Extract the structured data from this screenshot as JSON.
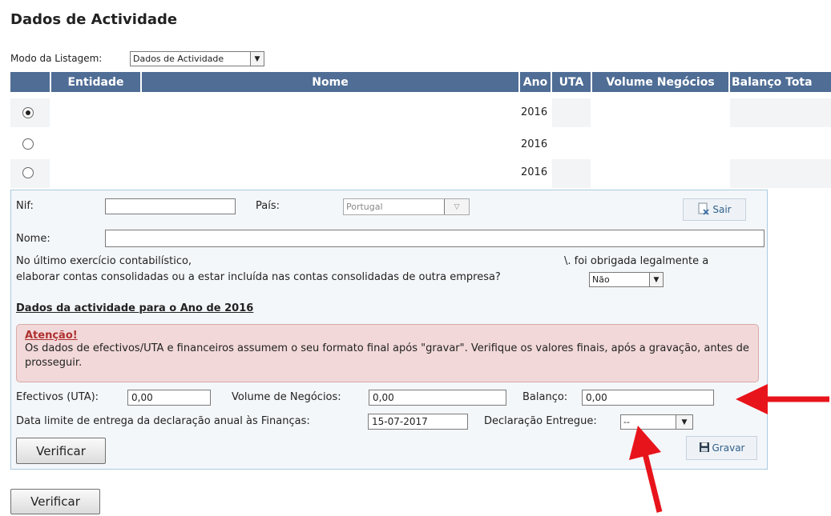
{
  "page": {
    "title": "Dados de Actividade"
  },
  "listing": {
    "mode_label": "Modo da Listagem:",
    "mode_value": "Dados de Actividade"
  },
  "table": {
    "headers": [
      "Entidade",
      "Nome",
      "Ano",
      "UTA",
      "Volume Negócios",
      "Balanço Tota"
    ],
    "rows": [
      {
        "selected": true,
        "year": "2016"
      },
      {
        "selected": false,
        "year": "2016"
      },
      {
        "selected": false,
        "year": "2016"
      }
    ]
  },
  "form": {
    "nif_label": "Nif:",
    "nif_value": "",
    "pais_label": "País:",
    "pais_value": "Portugal",
    "sair_label": "Sair",
    "nome_label": "Nome:",
    "nome_value": "",
    "question_part1": "No último exercício contabilístico,",
    "question_part2": "\\. foi obrigada legalmente a",
    "question_line2": "elaborar contas consolidadas ou a estar incluída nas contas consolidadas de outra empresa?",
    "consolidated_value": "Não",
    "section_title": "Dados  da actividade para o Ano de 2016",
    "alert_title": "Atenção!",
    "alert_message": "Os dados de efectivos/UTA e financeiros assumem o seu formato final após \"gravar\". Verifique os valores finais, após a gravação, antes de prosseguir.",
    "efectivos_label": "Efectivos (UTA):",
    "efectivos_value": "0,00",
    "volume_label": "Volume de Negócios:",
    "volume_value": "0,00",
    "balanco_label": "Balanço:",
    "balanco_value": "0,00",
    "data_limite_label": "Data limite de entrega da declaração anual às Finanças:",
    "data_limite_value": "15-07-2017",
    "declaracao_label": "Declaração Entregue:",
    "declaracao_value": "--",
    "verificar_label": "Verificar",
    "gravar_label": "Gravar"
  },
  "footer": {
    "verificar_label": "Verificar"
  },
  "colors": {
    "header_bg": "#4f6d95",
    "arrow": "#e8141b",
    "alert_bg": "#f2d8d8",
    "alert_title": "#b03030"
  },
  "icons": [
    "chevron-down-icon",
    "exit-icon",
    "save-icon",
    "arrow-annotation"
  ]
}
